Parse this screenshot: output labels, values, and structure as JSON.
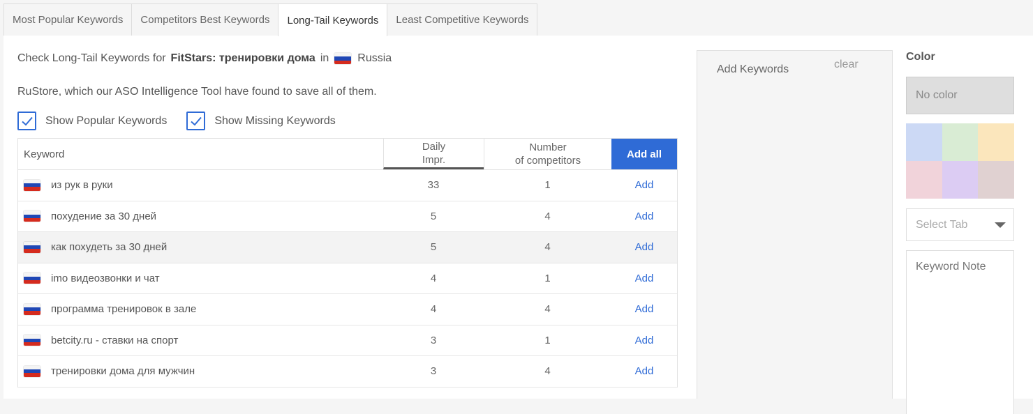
{
  "tabs": [
    {
      "label": "Most Popular Keywords",
      "active": false
    },
    {
      "label": "Competitors Best Keywords",
      "active": false
    },
    {
      "label": "Long-Tail Keywords",
      "active": true
    },
    {
      "label": "Least Competitive Keywords",
      "active": false
    }
  ],
  "intro": {
    "prefix": "Check Long-Tail Keywords for",
    "app": "FitStars: тренировки дома",
    "in": "in",
    "country": "Russia",
    "description": "RuStore, which our ASO Intelligence Tool have found to save all of them."
  },
  "checkboxes": {
    "popular": {
      "label": "Show Popular Keywords",
      "checked": true
    },
    "missing": {
      "label": "Show Missing Keywords",
      "checked": true
    }
  },
  "table": {
    "headers": {
      "keyword": "Keyword",
      "daily_line1": "Daily",
      "daily_line2": "Impr.",
      "competitors_line1": "Number",
      "competitors_line2": "of competitors",
      "add_all": "Add all"
    },
    "rows": [
      {
        "keyword": "из рук в руки",
        "daily": "33",
        "competitors": "1",
        "action": "Add"
      },
      {
        "keyword": "похудение за 30 дней",
        "daily": "5",
        "competitors": "4",
        "action": "Add"
      },
      {
        "keyword": "как похудеть за 30 дней",
        "daily": "5",
        "competitors": "4",
        "action": "Add"
      },
      {
        "keyword": "imo видеозвонки и чат",
        "daily": "4",
        "competitors": "1",
        "action": "Add"
      },
      {
        "keyword": "программа тренировок в зале",
        "daily": "4",
        "competitors": "4",
        "action": "Add"
      },
      {
        "keyword": "betcity.ru - ставки на спорт",
        "daily": "3",
        "competitors": "1",
        "action": "Add"
      },
      {
        "keyword": "тренировки дома для мужчин",
        "daily": "3",
        "competitors": "4",
        "action": "Add"
      }
    ]
  },
  "add_keywords": {
    "placeholder": "Add Keywords",
    "clear_label": "clear"
  },
  "sidebar": {
    "color_label": "Color",
    "no_color_label": "No color",
    "swatches": [
      "#ccd9f5",
      "#d9ecd4",
      "#fbe6bc",
      "#f1d3da",
      "#dcccf3",
      "#e0d1d1"
    ],
    "select_tab_placeholder": "Select Tab",
    "keyword_note_placeholder": "Keyword Note"
  },
  "colors": {
    "accent": "#2f6bd6"
  }
}
